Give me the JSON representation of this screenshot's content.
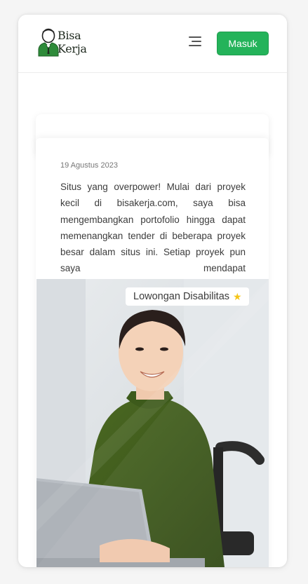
{
  "header": {
    "logo": {
      "line1": "Bisa",
      "line2": "Kerja"
    },
    "menu_icon": "menu-lines-icon",
    "login_label": "Masuk"
  },
  "testimonial": {
    "date": "19 Agustus 2023",
    "text": "Situs yang overpower! Mulai dari proyek kecil di bisakerja.com, saya bisa mengembangkan portofolio hingga dapat memenangkan tender di beberapa proyek besar dalam situs ini. Setiap proyek pun saya mendapat"
  },
  "photo": {
    "badge_label": "Lowongan Disabilitas",
    "badge_icon": "star-icon"
  },
  "colors": {
    "accent": "#24b35a",
    "logo_green": "#2e8b3a",
    "shirt": "#3f5a1c"
  }
}
